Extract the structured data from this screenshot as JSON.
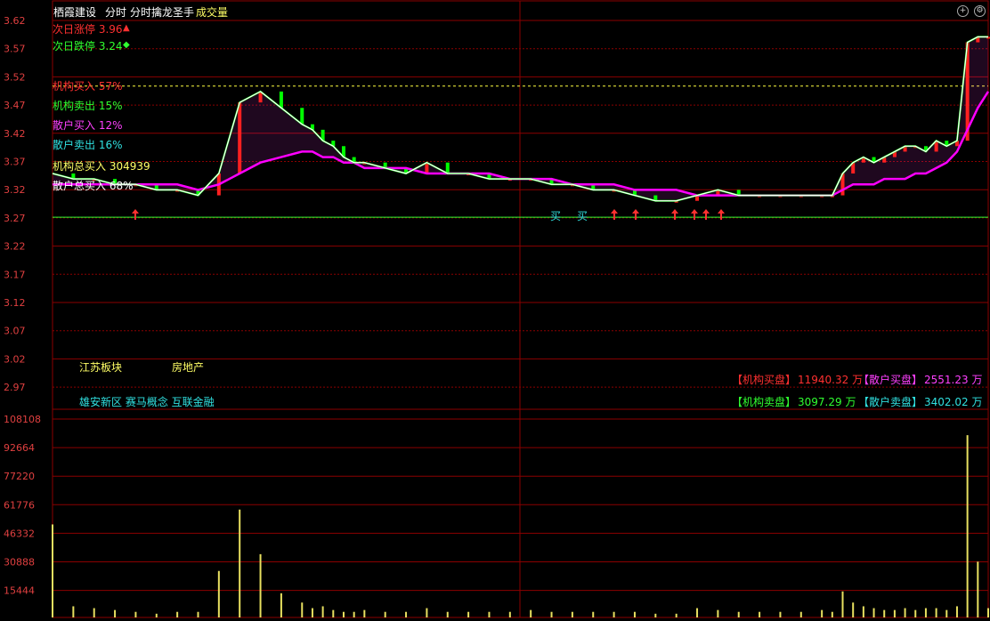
{
  "header": {
    "stock_name": "栖霞建设",
    "mode": "分时",
    "indicator": "分时擒龙圣手",
    "volume_label": "成交量"
  },
  "legend": {
    "next_limit_up": "次日涨停 3.96",
    "next_limit_down": "次日跌停 3.24",
    "inst_buy": "机构买入 57%",
    "inst_sell": "机构卖出 15%",
    "retail_buy": "散户买入 12%",
    "retail_sell": "散户卖出 16%",
    "inst_total_buy": "机构总买入 304939",
    "retail_total_buy": "散户总买入 68%"
  },
  "tags": {
    "sector": "江苏板块",
    "industry": "房地产",
    "concepts": "雄安新区 赛马概念 互联金融"
  },
  "summary": {
    "inst_buy_label": "【机构买盘】",
    "inst_buy_value": "11940.32 万",
    "retail_buy_label": "【散户买盘】",
    "retail_buy_value": "2551.23 万",
    "inst_sell_label": "【机构卖盘】",
    "inst_sell_value": "3097.29 万",
    "retail_sell_label": "【散户卖盘】",
    "retail_sell_value": "3402.02 万"
  },
  "markers": {
    "buy_text": "买"
  },
  "colors": {
    "price": "#ffffff",
    "avg": "#ff00ff",
    "fast_line": "#00ff00",
    "up_bar": "#ff2020",
    "down_bar": "#00ff00",
    "volume": "#e8e060",
    "grid": "#8b0000",
    "axis_price": "#e04040"
  },
  "chart_data": {
    "type": "line",
    "price_ticks": [
      "3.62",
      "3.57",
      "3.52",
      "3.47",
      "3.42",
      "3.37",
      "3.32",
      "3.27",
      "3.22",
      "3.17",
      "3.12",
      "3.07",
      "3.02",
      "2.97"
    ],
    "volume_ticks": [
      "108108",
      "92664",
      "77220",
      "61776",
      "46332",
      "30888",
      "15444"
    ],
    "ylim_price": [
      2.94,
      3.64
    ],
    "ylim_volume": [
      0,
      108108
    ],
    "reference_lines": {
      "upper": 3.52,
      "lower": 3.28
    },
    "x": [
      0,
      8,
      16,
      24,
      32,
      40,
      48,
      56,
      64,
      72,
      80,
      88,
      96,
      100,
      104,
      108,
      112,
      116,
      120,
      128,
      136,
      144,
      152,
      160,
      168,
      176,
      184,
      192,
      200,
      208,
      216,
      224,
      232,
      240,
      248,
      256,
      264,
      272,
      280,
      288,
      296,
      300,
      304,
      308,
      312,
      316,
      320,
      324,
      328,
      332,
      336,
      340,
      344,
      348,
      352,
      356,
      360
    ],
    "series": [
      {
        "values": [
          3.36,
          3.35,
          3.35,
          3.34,
          3.34,
          3.33,
          3.33,
          3.32,
          3.36,
          3.49,
          3.51,
          3.48,
          3.45,
          3.44,
          3.42,
          3.41,
          3.39,
          3.38,
          3.38,
          3.37,
          3.36,
          3.38,
          3.36,
          3.36,
          3.35,
          3.35,
          3.35,
          3.34,
          3.34,
          3.33,
          3.33,
          3.32,
          3.31,
          3.31,
          3.32,
          3.33,
          3.32,
          3.32,
          3.32,
          3.32,
          3.32,
          3.32,
          3.36,
          3.38,
          3.39,
          3.38,
          3.39,
          3.4,
          3.41,
          3.41,
          3.4,
          3.42,
          3.41,
          3.42,
          3.6,
          3.61,
          3.61
        ]
      },
      {
        "values": [
          3.34,
          3.34,
          3.34,
          3.34,
          3.34,
          3.34,
          3.34,
          3.33,
          3.34,
          3.36,
          3.38,
          3.39,
          3.4,
          3.4,
          3.39,
          3.39,
          3.38,
          3.38,
          3.37,
          3.37,
          3.37,
          3.36,
          3.36,
          3.36,
          3.36,
          3.35,
          3.35,
          3.35,
          3.34,
          3.34,
          3.34,
          3.33,
          3.33,
          3.33,
          3.32,
          3.32,
          3.32,
          3.32,
          3.32,
          3.32,
          3.32,
          3.32,
          3.33,
          3.34,
          3.34,
          3.34,
          3.35,
          3.35,
          3.35,
          3.36,
          3.36,
          3.37,
          3.38,
          3.4,
          3.44,
          3.48,
          3.51
        ]
      }
    ],
    "volume_values": [
      50000,
      6000,
      5000,
      4000,
      3000,
      2000,
      3000,
      3000,
      25000,
      58000,
      34000,
      13000,
      8000,
      5000,
      6000,
      4000,
      3000,
      3000,
      4000,
      3000,
      3000,
      5000,
      3000,
      3000,
      3000,
      3000,
      4000,
      3000,
      3000,
      3000,
      3000,
      3000,
      2000,
      2000,
      5000,
      4000,
      3000,
      3000,
      3000,
      3000,
      4000,
      3000,
      14000,
      8000,
      6000,
      5000,
      4000,
      4000,
      5000,
      4000,
      5000,
      5000,
      4000,
      6000,
      98000,
      30000,
      5000
    ]
  }
}
